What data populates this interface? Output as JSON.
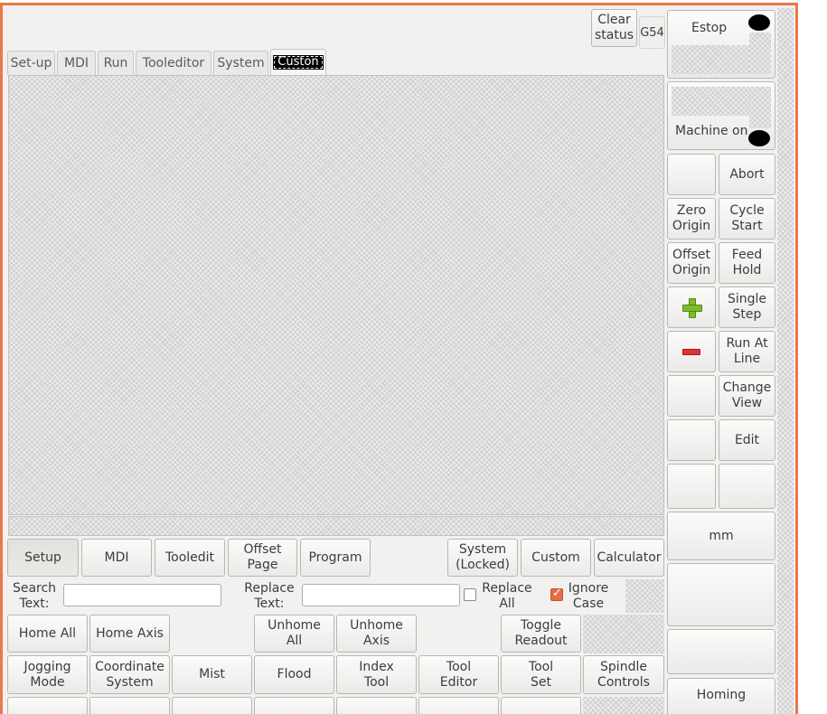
{
  "header": {
    "clear_status": "Clear\nstatus",
    "coord_system": "G54"
  },
  "tabs": [
    {
      "label": "Set-up"
    },
    {
      "label": "MDI"
    },
    {
      "label": "Run"
    },
    {
      "label": "Tooleditor"
    },
    {
      "label": "System"
    },
    {
      "label": "Custon",
      "active": true
    }
  ],
  "mode_buttons": {
    "setup": "Setup",
    "mdi": "MDI",
    "tooledit": "Tooledit",
    "offset_page": "Offset\nPage",
    "program": "Program",
    "system": "System\n(Locked)",
    "custom": "Custom",
    "calculator": "Calculator"
  },
  "search_bar": {
    "search_label": "Search\nText:",
    "search_value": "",
    "replace_label": "Replace\nText:",
    "replace_value": "",
    "replace_all_label": "Replace\nAll",
    "replace_all_checked": false,
    "ignore_case_label": "Ignore\nCase",
    "ignore_case_checked": true
  },
  "bottom_row1": {
    "home_all": "Home All",
    "home_axis": "Home Axis",
    "unhome_all": "Unhome\nAll",
    "unhome_axis": "Unhome\nAxis",
    "toggle_readout": "Toggle\nReadout"
  },
  "bottom_row2": {
    "jogging_mode": "Jogging\nMode",
    "coordinate_system": "Coordinate\nSystem",
    "mist": "Mist",
    "flood": "Flood",
    "index_tool": "Index\nTool",
    "tool_editor": "Tool\nEditor",
    "tool_set": "Tool\nSet",
    "spindle_controls": "Spindle\nControls"
  },
  "right_panel": {
    "estop": "Estop",
    "machine_on": "Machine on",
    "abort": "Abort",
    "zero_origin": "Zero\nOrigin",
    "cycle_start": "Cycle\nStart",
    "offset_origin": "Offset\nOrigin",
    "feed_hold": "Feed\nHold",
    "single_step": "Single\nStep",
    "run_at_line": "Run At\nLine",
    "change_view": "Change\nView",
    "edit": "Edit",
    "units": "mm",
    "homing": "Homing"
  },
  "colors": {
    "frame_border": "#e9784a",
    "check_on": "#ea6c44",
    "plus_icon": "#7dbb2a",
    "minus_icon": "#e0332e"
  }
}
